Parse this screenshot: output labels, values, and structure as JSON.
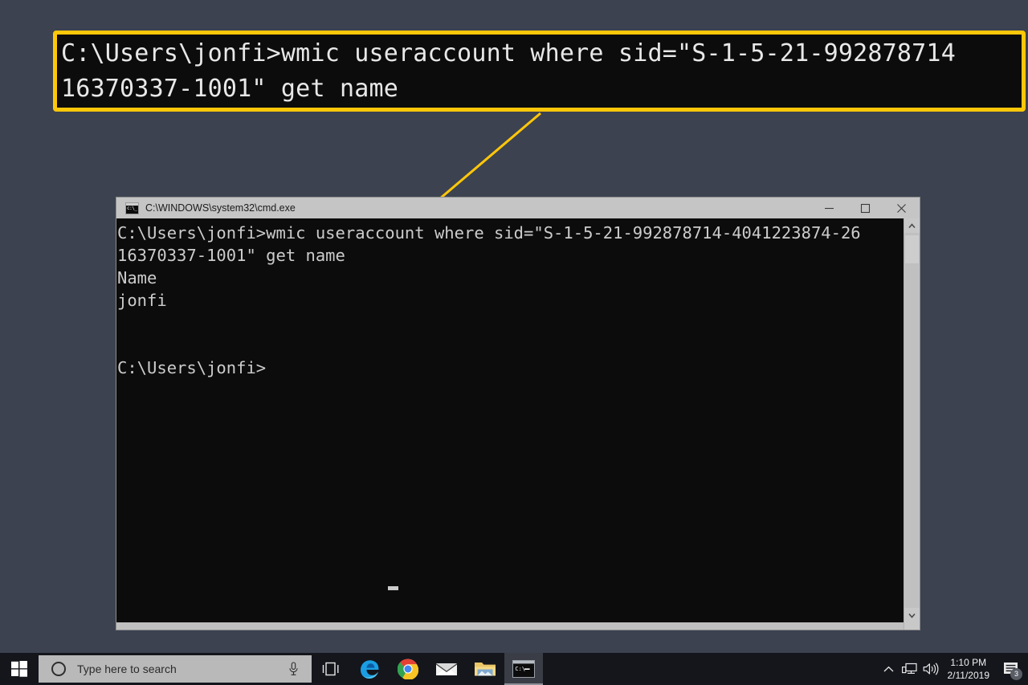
{
  "callout": {
    "name": "zoomed-command-callout",
    "border_color": "#ffc709",
    "background": "#0c0c0c",
    "text": "C:\\Users\\jonfi>wmic useraccount where sid=\"S-1-5-21-992878714\n16370337-1001\" get name"
  },
  "window": {
    "title": "C:\\WINDOWS\\system32\\cmd.exe",
    "icon": "cmd-icon",
    "controls": {
      "minimize": "—",
      "maximize": "□",
      "close": "✕"
    },
    "console": {
      "background": "#0c0c0c",
      "foreground": "#cccccc",
      "text": "C:\\Users\\jonfi>wmic useraccount where sid=\"S-1-5-21-992878714-4041223874-26\n16370337-1001\" get name\nName\njonfi\n\n\nC:\\Users\\jonfi>",
      "lines": [
        "C:\\Users\\jonfi>wmic useraccount where sid=\"S-1-5-21-992878714-4041223874-26",
        "16370337-1001\" get name",
        "Name",
        "jonfi",
        "",
        "",
        "C:\\Users\\jonfi>"
      ],
      "cursor": "_"
    },
    "scrollbar": {
      "up_arrow": "⌃",
      "down_arrow": "⌄"
    }
  },
  "taskbar": {
    "start": "start-button",
    "search": {
      "placeholder": "Type here to search",
      "cortana_icon": "cortana-circle-icon",
      "mic_icon": "microphone-icon"
    },
    "items": [
      {
        "name": "task-view",
        "label": "Task View"
      },
      {
        "name": "edge",
        "label": "Microsoft Edge"
      },
      {
        "name": "chrome",
        "label": "Google Chrome"
      },
      {
        "name": "mail",
        "label": "Mail"
      },
      {
        "name": "file-explorer",
        "label": "File Explorer"
      },
      {
        "name": "command-prompt",
        "label": "Command Prompt",
        "active": true
      }
    ],
    "tray": {
      "show_hidden": "⌃",
      "network_icon": "network-icon",
      "volume_icon": "volume-icon",
      "time": "1:10 PM",
      "date": "2/11/2019",
      "notification_count": "3"
    }
  },
  "desktop": {
    "background": "#3c4250"
  }
}
